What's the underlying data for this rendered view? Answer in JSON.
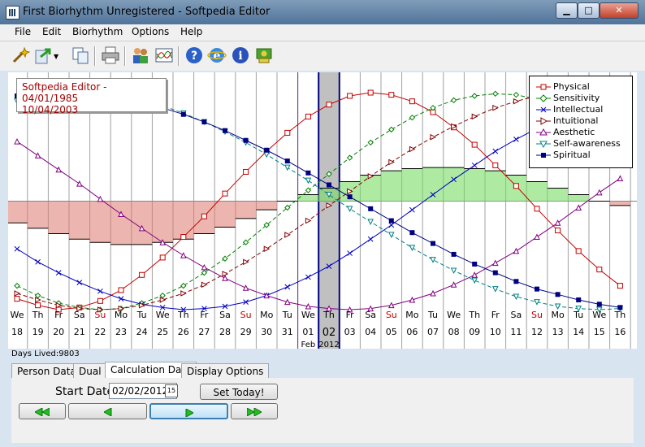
{
  "window": {
    "title": "First Biorhythm Unregistered - Softpedia Editor",
    "minimize_label": "▁",
    "maximize_label": "□",
    "close_label": "✕"
  },
  "menu": [
    "File",
    "Edit",
    "Biorhythm",
    "Options",
    "Help"
  ],
  "toolbar": {
    "icons": [
      "wizard-icon",
      "export-icon",
      "copy-icon",
      "print-icon",
      "persons-icon",
      "chart-icon",
      "help-icon",
      "web-icon",
      "info-icon",
      "register-icon"
    ]
  },
  "chart": {
    "person_name": "Softpedia Editor - 04/01/1985",
    "target_date": "10/04/2003",
    "days_lived_label": "Days Lived:9803",
    "highlight_color": "#c0c0c0",
    "selected_day": "02",
    "month_label": "Feb",
    "year_label": "2012",
    "days": [
      {
        "dow": "We",
        "num": "18"
      },
      {
        "dow": "Th",
        "num": "19"
      },
      {
        "dow": "Fr",
        "num": "20"
      },
      {
        "dow": "Sa",
        "num": "21"
      },
      {
        "dow": "Su",
        "num": "22"
      },
      {
        "dow": "Mo",
        "num": "23"
      },
      {
        "dow": "Tu",
        "num": "24"
      },
      {
        "dow": "We",
        "num": "25"
      },
      {
        "dow": "Th",
        "num": "26"
      },
      {
        "dow": "Fr",
        "num": "27"
      },
      {
        "dow": "Sa",
        "num": "28"
      },
      {
        "dow": "Su",
        "num": "29"
      },
      {
        "dow": "Mo",
        "num": "30"
      },
      {
        "dow": "Tu",
        "num": "31"
      },
      {
        "dow": "We",
        "num": "01"
      },
      {
        "dow": "Th",
        "num": "02"
      },
      {
        "dow": "Fr",
        "num": "03"
      },
      {
        "dow": "Sa",
        "num": "04"
      },
      {
        "dow": "Su",
        "num": "05"
      },
      {
        "dow": "Mo",
        "num": "06"
      },
      {
        "dow": "Tu",
        "num": "07"
      },
      {
        "dow": "We",
        "num": "08"
      },
      {
        "dow": "Th",
        "num": "09"
      },
      {
        "dow": "Fr",
        "num": "10"
      },
      {
        "dow": "Sa",
        "num": "11"
      },
      {
        "dow": "Su",
        "num": "12"
      },
      {
        "dow": "Mo",
        "num": "13"
      },
      {
        "dow": "Tu",
        "num": "14"
      },
      {
        "dow": "We",
        "num": "15"
      },
      {
        "dow": "Th",
        "num": "16"
      }
    ]
  },
  "legend": [
    {
      "name": "Physical",
      "color": "#c00000",
      "marker": "square"
    },
    {
      "name": "Sensitivity",
      "color": "#008000",
      "marker": "diamond"
    },
    {
      "name": "Intellectual",
      "color": "#0000c0",
      "marker": "x"
    },
    {
      "name": "Intuitional",
      "color": "#800000",
      "marker": "triangle-right"
    },
    {
      "name": "Aesthetic",
      "color": "#800080",
      "marker": "triangle-up"
    },
    {
      "name": "Self-awareness",
      "color": "#008080",
      "marker": "triangle-down"
    },
    {
      "name": "Spiritual",
      "color": "#000080",
      "marker": "square-filled"
    }
  ],
  "chart_data": {
    "type": "line",
    "x": [
      "18",
      "19",
      "20",
      "21",
      "22",
      "23",
      "24",
      "25",
      "26",
      "27",
      "28",
      "29",
      "30",
      "31",
      "01",
      "02",
      "03",
      "04",
      "05",
      "06",
      "07",
      "08",
      "09",
      "10",
      "11",
      "12",
      "13",
      "14",
      "15",
      "16"
    ],
    "ylim": [
      -100,
      100
    ],
    "series": [
      {
        "name": "Physical",
        "period": 23,
        "values": [
          -90,
          -96,
          -100,
          -98,
          -92,
          -82,
          -68,
          -52,
          -33,
          -14,
          7,
          27,
          46,
          63,
          78,
          89,
          97,
          100,
          98,
          92,
          82,
          68,
          52,
          33,
          14,
          -7,
          -27,
          -46,
          -63,
          -78
        ]
      },
      {
        "name": "Sensitivity",
        "period": 28,
        "values": [
          -78,
          -87,
          -94,
          -98,
          -100,
          -99,
          -94,
          -87,
          -78,
          -66,
          -53,
          -38,
          -22,
          -6,
          10,
          25,
          40,
          54,
          66,
          77,
          86,
          93,
          97,
          99,
          98,
          94,
          88,
          79,
          68,
          55
        ]
      },
      {
        "name": "Intellectual",
        "period": 33,
        "values": [
          -44,
          -56,
          -66,
          -75,
          -83,
          -90,
          -95,
          -98,
          -100,
          -99,
          -97,
          -93,
          -87,
          -79,
          -70,
          -60,
          -48,
          -35,
          -22,
          -8,
          6,
          20,
          33,
          46,
          57,
          67,
          76,
          84,
          90,
          95
        ]
      },
      {
        "name": "Intuitional",
        "period": 38,
        "values": [
          -85,
          -91,
          -96,
          -99,
          -100,
          -99,
          -96,
          -91,
          -85,
          -77,
          -67,
          -56,
          -44,
          -31,
          -18,
          -4,
          9,
          23,
          36,
          48,
          59,
          69,
          78,
          86,
          92,
          97,
          99,
          100,
          99,
          96
        ]
      },
      {
        "name": "Aesthetic",
        "period": 43,
        "values": [
          55,
          42,
          29,
          16,
          2,
          -12,
          -25,
          -38,
          -50,
          -61,
          -71,
          -80,
          -87,
          -93,
          -97,
          -99,
          -100,
          -99,
          -96,
          -91,
          -85,
          -77,
          -68,
          -57,
          -46,
          -33,
          -20,
          -6,
          8,
          21
        ]
      },
      {
        "name": "Self-awareness",
        "period": 48,
        "values": [
          92,
          96,
          99,
          100,
          99,
          97,
          93,
          88,
          81,
          73,
          64,
          54,
          43,
          31,
          19,
          6,
          -7,
          -19,
          -31,
          -43,
          -54,
          -64,
          -73,
          -81,
          -88,
          -93,
          -97,
          -99,
          -100,
          -99
        ]
      },
      {
        "name": "Spiritual",
        "period": 53,
        "values": [
          97,
          99,
          100,
          100,
          98,
          95,
          91,
          86,
          80,
          73,
          65,
          56,
          47,
          37,
          26,
          15,
          4,
          -7,
          -18,
          -29,
          -39,
          -49,
          -58,
          -66,
          -74,
          -81,
          -86,
          -91,
          -95,
          -98
        ]
      }
    ],
    "average_band": [
      -20,
      -25,
      -30,
      -35,
      -38,
      -40,
      -40,
      -38,
      -35,
      -30,
      -24,
      -16,
      -8,
      0,
      6,
      12,
      18,
      24,
      28,
      30,
      31,
      31,
      30,
      28,
      24,
      18,
      12,
      6,
      0,
      -4
    ]
  },
  "tabs": [
    "Person Data",
    "Dual",
    "Calculation Date",
    "Display Options"
  ],
  "active_tab": "Calculation Date",
  "panel": {
    "start_date_label": "Start Date",
    "start_date_value": "02/02/2012",
    "calendar_icon_label": "15",
    "set_today_label": "Set Today!"
  }
}
